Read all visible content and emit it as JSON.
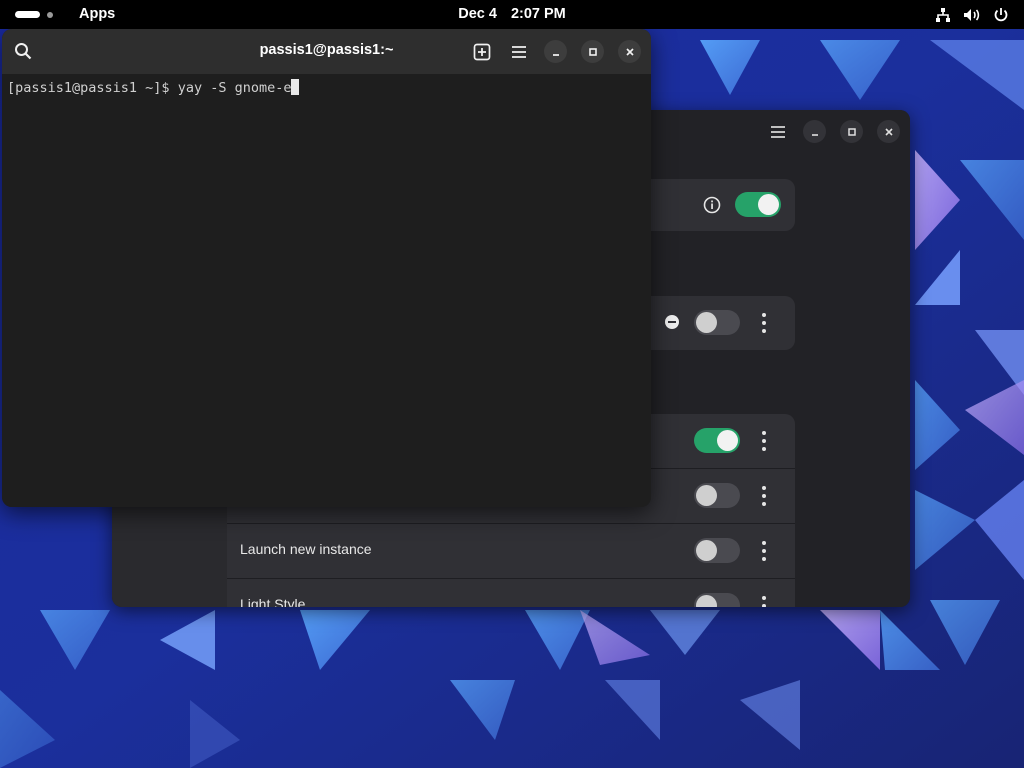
{
  "topbar": {
    "activities_label": "Apps",
    "date": "Dec 4",
    "time": "2:07 PM",
    "tray_icons": [
      "network-icon",
      "volume-icon",
      "power-icon"
    ]
  },
  "terminal": {
    "title": "passis1@passis1:~",
    "prompt": "[passis1@passis1 ~]$ ",
    "command": "yay -S gnome-e",
    "header_buttons": [
      "search-icon",
      "new-tab-icon",
      "menu-icon",
      "minimize-icon",
      "maximize-icon",
      "close-icon"
    ]
  },
  "settings_window": {
    "rows": [
      {
        "label": "",
        "switch_on": true,
        "trailing_icon": "info-icon"
      },
      {
        "label": "",
        "switch_on": false,
        "trailing_icon": "remove-icon"
      },
      {
        "label": "",
        "switch_on": true
      },
      {
        "label": "",
        "switch_on": false
      },
      {
        "label": "Launch new instance",
        "switch_on": false
      },
      {
        "label": "Light Style",
        "switch_on": false
      }
    ]
  },
  "colors": {
    "switch_on": "#26a269",
    "topbar": "#000000",
    "terminal_bg": "#1e1e1e",
    "wallpaper_base": "#1b2a8c"
  }
}
